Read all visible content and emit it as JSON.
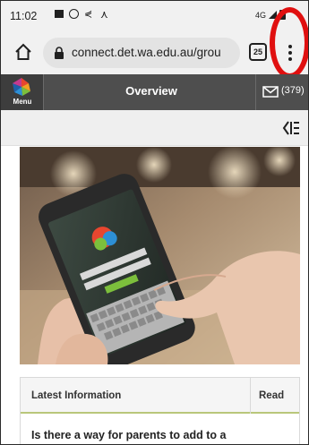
{
  "status_bar": {
    "time": "11:02",
    "network": "4G"
  },
  "browser": {
    "url": "connect.det.wa.edu.au/grou",
    "tab_count": "25"
  },
  "site_header": {
    "menu_label": "Menu",
    "title": "Overview",
    "message_count": "(379)"
  },
  "info_panel": {
    "title": "Latest Information",
    "read_label": "Read",
    "first_item": "Is there a way for parents to add to a"
  },
  "colors": {
    "annotation_circle": "#e01010",
    "header_bg": "#4e4e4e",
    "accent_border": "#b9c77a"
  },
  "icons": [
    "home-icon",
    "lock-icon",
    "tabs-icon",
    "kebab-menu-icon",
    "logo-icon",
    "mail-icon",
    "collapse-sidebar-icon"
  ]
}
